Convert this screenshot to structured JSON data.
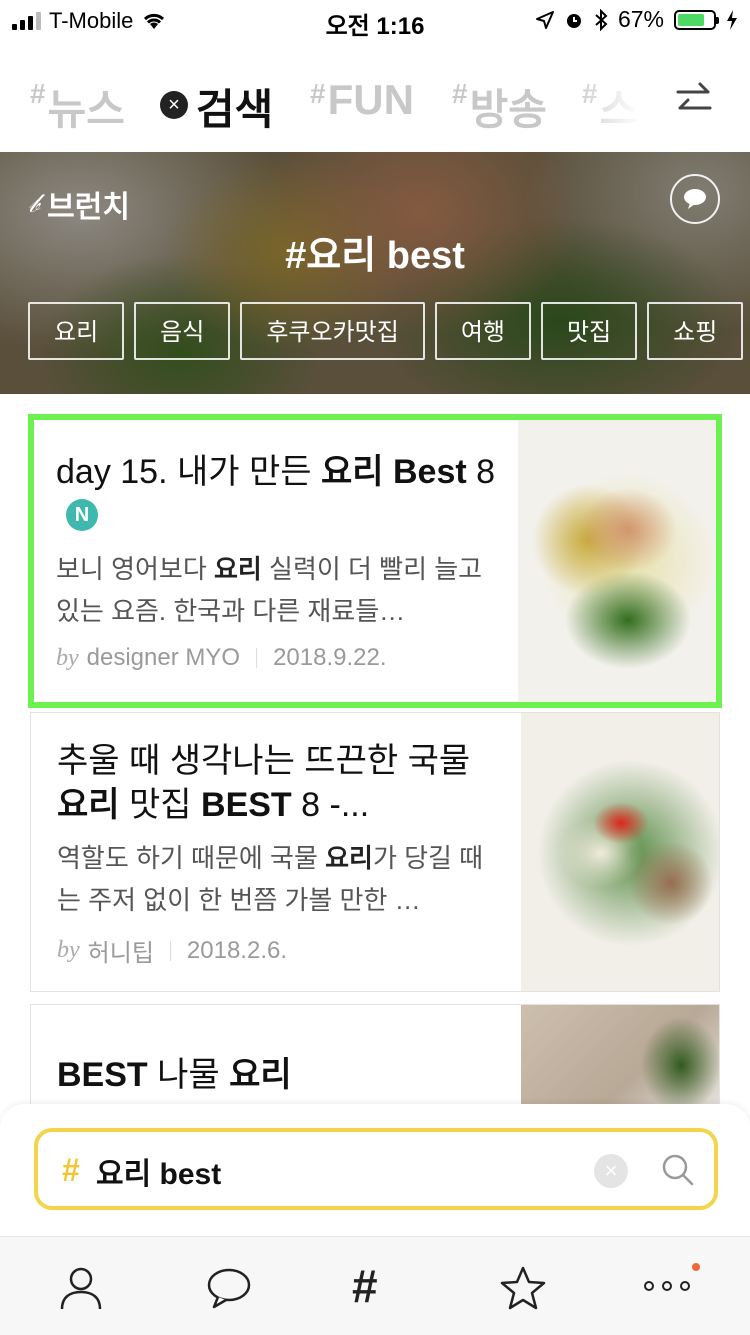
{
  "status_bar": {
    "carrier": "T-Mobile",
    "time": "오전 1:16",
    "battery": "67%",
    "battery_level": 0.67
  },
  "tabs": [
    {
      "label": "뉴스",
      "active": false
    },
    {
      "label": "검색",
      "active": true
    },
    {
      "label": "FUN",
      "active": false
    },
    {
      "label": "방송",
      "active": false
    },
    {
      "label": "스",
      "active": false
    }
  ],
  "hero": {
    "brand": "브런치",
    "title": "#요리 best",
    "chips": [
      "요리",
      "음식",
      "후쿠오카맛집",
      "여행",
      "맛집",
      "쇼핑"
    ]
  },
  "articles": [
    {
      "title_pre": "day 15. 내가 만든 ",
      "title_bold": "요리 Best",
      "title_post": " 8",
      "badge": "N",
      "summary_pre": "보니 영어보다 ",
      "summary_bold": "요리",
      "summary_post": " 실력이 더 빨리 늘고 있는 요즘. 한국과 다른 재료들…",
      "by": "by",
      "author": "designer MYO",
      "date": "2018.9.22."
    },
    {
      "title_pre": "추울 때 생각나는 뜨끈한 국물 ",
      "title_bold": "요리",
      "title_mid": " 맛집 ",
      "title_bold2": "BEST",
      "title_post": " 8 -...",
      "summary_pre": "역할도 하기 때문에 국물 ",
      "summary_bold": "요리",
      "summary_post": "가 당길 때는 주저 없이 한 번쯤 가볼 만한 …",
      "by": "by",
      "author": "허니팁",
      "date": "2018.2.6."
    },
    {
      "title_bold": "BEST",
      "title_mid": " 나물 ",
      "title_bold2": "요리"
    }
  ],
  "search": {
    "hash": "#",
    "value": "요리 best"
  },
  "colors": {
    "highlight": "#6df14e",
    "search_border": "#f3d44a",
    "badge": "#3fb8b0",
    "notification": "#f0673a"
  },
  "bottom_nav": [
    "person-icon",
    "chat-bubble-icon",
    "hashtag-icon",
    "star-icon",
    "more-icon"
  ]
}
